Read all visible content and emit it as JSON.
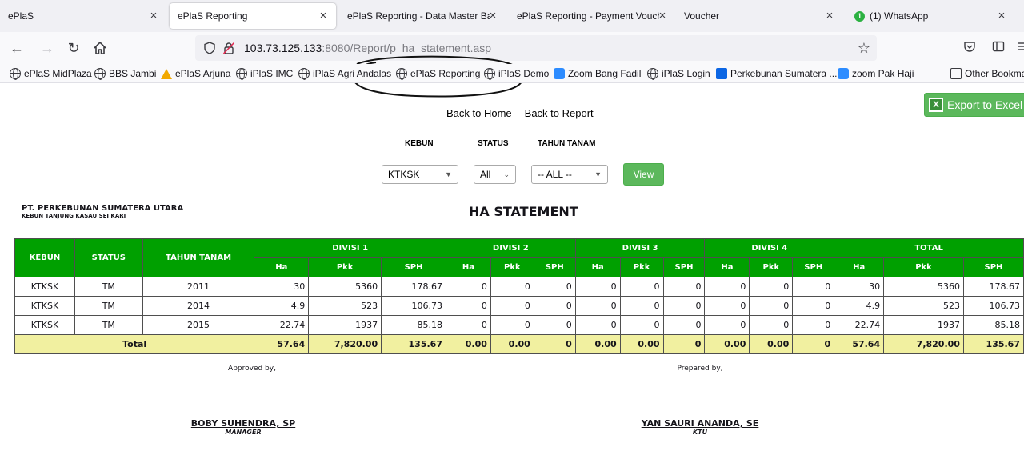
{
  "browser": {
    "tabs": [
      {
        "label": "ePlaS",
        "active": false
      },
      {
        "label": "ePlaS Reporting",
        "active": true
      },
      {
        "label": "ePlaS Reporting - Data Master Bank",
        "active": false
      },
      {
        "label": "ePlaS Reporting - Payment Voucher",
        "active": false
      },
      {
        "label": "Voucher",
        "active": false
      },
      {
        "label": "(1) WhatsApp",
        "active": false,
        "badge": "1"
      }
    ],
    "close_glyph": "×",
    "url_host": "103.73.125.133",
    "url_rest": ":8080/Report/p_ha_statement.asp",
    "bookmarks": [
      {
        "label": "ePlaS MidPlaza",
        "icon": "globe-icon"
      },
      {
        "label": "BBS Jambi",
        "icon": "globe-icon"
      },
      {
        "label": "ePlaS Arjuna",
        "icon": "arjuna-icon"
      },
      {
        "label": "iPlaS IMC",
        "icon": "globe-icon"
      },
      {
        "label": "iPlaS Agri Andalas",
        "icon": "globe-icon"
      },
      {
        "label": "ePlaS Reporting",
        "icon": "globe-icon"
      },
      {
        "label": "iPlaS Demo",
        "icon": "globe-icon"
      },
      {
        "label": "Zoom Bang Fadil",
        "icon": "zoom-icon"
      },
      {
        "label": "iPlaS Login",
        "icon": "globe-icon"
      },
      {
        "label": "Perkebunan Sumatera ...",
        "icon": "trello-icon"
      },
      {
        "label": "zoom Pak Haji",
        "icon": "zoom-icon"
      }
    ],
    "other_bookmarks": "Other Bookma"
  },
  "page": {
    "back_home": "Back to Home",
    "back_report": "Back to Report",
    "export": "Export to Excel",
    "filters": {
      "kebun_label": "KEBUN",
      "status_label": "STATUS",
      "tahun_label": "TAHUN TANAM",
      "kebun_value": "KTKSK",
      "status_value": "All",
      "tahun_value": "-- ALL --",
      "view": "View"
    },
    "company": "PT. PERKEBUNAN SUMATERA UTARA",
    "estate": "KEBUN TANJUNG KASAU SEI KARI",
    "report_title": "HA STATEMENT",
    "table": {
      "col_kebun": "KEBUN",
      "col_status": "STATUS",
      "col_tahun": "TAHUN TANAM",
      "groups": [
        "DIVISI 1",
        "DIVISI 2",
        "DIVISI 3",
        "DIVISI 4",
        "TOTAL"
      ],
      "sub": [
        "Ha",
        "Pkk",
        "SPH"
      ],
      "rows": [
        {
          "kebun": "KTKSK",
          "status": "TM",
          "tahun": "2011",
          "vals": [
            "30",
            "5360",
            "178.67",
            "0",
            "0",
            "0",
            "0",
            "0",
            "0",
            "0",
            "0",
            "0",
            "30",
            "5360",
            "178.67"
          ]
        },
        {
          "kebun": "KTKSK",
          "status": "TM",
          "tahun": "2014",
          "vals": [
            "4.9",
            "523",
            "106.73",
            "0",
            "0",
            "0",
            "0",
            "0",
            "0",
            "0",
            "0",
            "0",
            "4.9",
            "523",
            "106.73"
          ]
        },
        {
          "kebun": "KTKSK",
          "status": "TM",
          "tahun": "2015",
          "vals": [
            "22.74",
            "1937",
            "85.18",
            "0",
            "0",
            "0",
            "0",
            "0",
            "0",
            "0",
            "0",
            "0",
            "22.74",
            "1937",
            "85.18"
          ]
        }
      ],
      "total_label": "Total",
      "total_vals": [
        "57.64",
        "7,820.00",
        "135.67",
        "0.00",
        "0.00",
        "0",
        "0.00",
        "0.00",
        "0",
        "0.00",
        "0.00",
        "0",
        "57.64",
        "7,820.00",
        "135.67"
      ]
    },
    "approved_by": "Approved by,",
    "prepared_by": "Prepared by,",
    "manager_name": "BOBY SUHENDRA, SP",
    "manager_role": "MANAGER",
    "ktu_name": "YAN SAURI ANANDA, SE",
    "ktu_role": "KTU"
  }
}
